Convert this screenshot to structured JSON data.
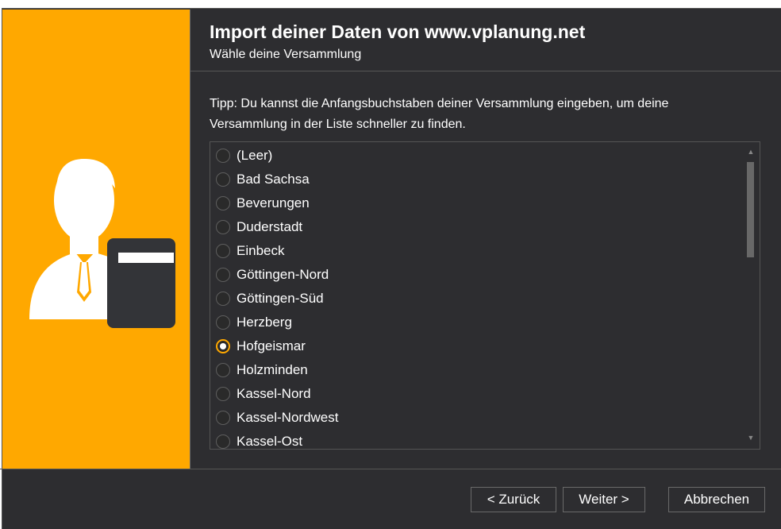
{
  "header": {
    "title": "Import deiner Daten von www.vplanung.net",
    "subtitle": "Wähle deine Versammlung"
  },
  "tip": "Tipp: Du kannst die Anfangsbuchstaben deiner Versammlung eingeben, um deine Versammlung in der Liste schneller zu finden.",
  "congregations": {
    "items": [
      {
        "label": "(Leer)",
        "selected": false
      },
      {
        "label": "Bad Sachsa",
        "selected": false
      },
      {
        "label": "Beverungen",
        "selected": false
      },
      {
        "label": "Duderstadt",
        "selected": false
      },
      {
        "label": "Einbeck",
        "selected": false
      },
      {
        "label": "Göttingen-Nord",
        "selected": false
      },
      {
        "label": "Göttingen-Süd",
        "selected": false
      },
      {
        "label": "Herzberg",
        "selected": false
      },
      {
        "label": "Hofgeismar",
        "selected": true
      },
      {
        "label": "Holzminden",
        "selected": false
      },
      {
        "label": "Kassel-Nord",
        "selected": false
      },
      {
        "label": "Kassel-Nordwest",
        "selected": false
      },
      {
        "label": "Kassel-Ost",
        "selected": false
      }
    ]
  },
  "footer": {
    "back_label": "< Zurück",
    "next_label": "Weiter >",
    "cancel_label": "Abbrechen"
  },
  "colors": {
    "accent": "#ffa800",
    "background": "#2d2d30",
    "text": "#ffffff"
  },
  "icons": {
    "banner": "user-with-book-icon",
    "scroll_up": "scroll-up-arrow-icon",
    "scroll_down": "scroll-down-arrow-icon"
  }
}
